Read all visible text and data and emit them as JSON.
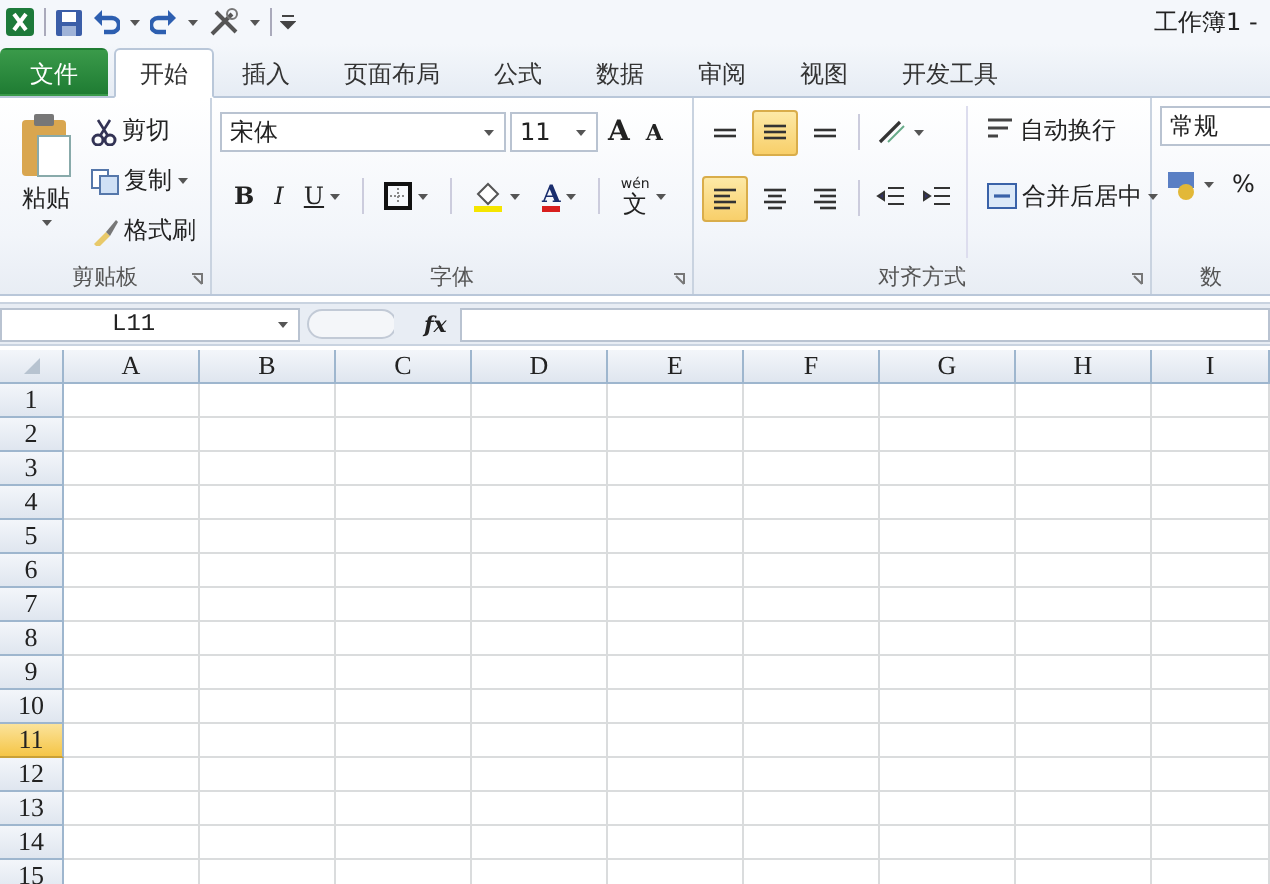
{
  "title_bar": {
    "title": "工作簿1 -"
  },
  "tabs": [
    {
      "label": "文件",
      "kind": "file",
      "selected": false
    },
    {
      "label": "开始",
      "kind": "tab",
      "selected": true
    },
    {
      "label": "插入",
      "kind": "tab",
      "selected": false
    },
    {
      "label": "页面布局",
      "kind": "tab",
      "selected": false
    },
    {
      "label": "公式",
      "kind": "tab",
      "selected": false
    },
    {
      "label": "数据",
      "kind": "tab",
      "selected": false
    },
    {
      "label": "审阅",
      "kind": "tab",
      "selected": false
    },
    {
      "label": "视图",
      "kind": "tab",
      "selected": false
    },
    {
      "label": "开发工具",
      "kind": "tab",
      "selected": false
    }
  ],
  "ribbon": {
    "clipboard": {
      "paste": "粘贴",
      "cut": "剪切",
      "copy": "复制",
      "format_painter": "格式刷",
      "group": "剪贴板"
    },
    "font": {
      "name": "宋体",
      "size": "11",
      "grow": "A",
      "shrink": "A",
      "bold": "B",
      "italic": "I",
      "underline": "U",
      "font_color": "A",
      "phonetic": "wén",
      "phonetic_char": "文",
      "group": "字体"
    },
    "alignment": {
      "buttons": [
        {
          "kind": "top",
          "selected": false
        },
        {
          "kind": "middle",
          "selected": true
        },
        {
          "kind": "bottom",
          "selected": false
        },
        {
          "kind": "left",
          "selected": true
        },
        {
          "kind": "center",
          "selected": false
        },
        {
          "kind": "right",
          "selected": false
        }
      ],
      "wrap": "自动换行",
      "merge": "合并后居中",
      "group": "对齐方式"
    },
    "number": {
      "format": "常规",
      "percent": "%",
      "group": "数"
    }
  },
  "formula_bar": {
    "name_box": "L11",
    "fx": "fx"
  },
  "grid": {
    "columns": [
      "A",
      "B",
      "C",
      "D",
      "E",
      "F",
      "G",
      "H",
      "I"
    ],
    "rows": [
      {
        "label": "1",
        "selected": false
      },
      {
        "label": "2",
        "selected": false
      },
      {
        "label": "3",
        "selected": false
      },
      {
        "label": "4",
        "selected": false
      },
      {
        "label": "5",
        "selected": false
      },
      {
        "label": "6",
        "selected": false
      },
      {
        "label": "7",
        "selected": false
      },
      {
        "label": "8",
        "selected": false
      },
      {
        "label": "9",
        "selected": false
      },
      {
        "label": "10",
        "selected": false
      },
      {
        "label": "11",
        "selected": true
      },
      {
        "label": "12",
        "selected": false
      },
      {
        "label": "13",
        "selected": false
      },
      {
        "label": "14",
        "selected": false
      },
      {
        "label": "15",
        "selected": false
      }
    ]
  }
}
